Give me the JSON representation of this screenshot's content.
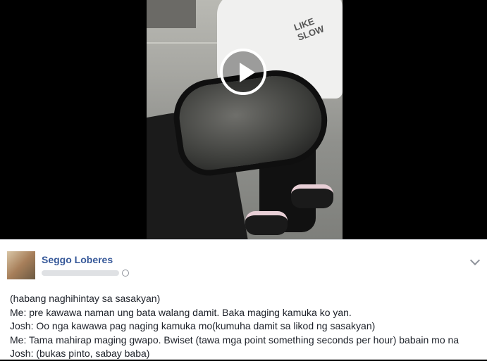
{
  "video": {
    "shirt_text": "LIKE SLOW",
    "play_icon": "play-circle-icon"
  },
  "post": {
    "author": "Seggo Loberes",
    "privacy_icon": "globe-icon",
    "menu_icon": "chevron-down-icon",
    "lines": [
      "(habang naghihintay sa sasakyan)",
      "Me: pre kawawa naman ung bata walang damit. Baka maging kamuka ko yan.",
      "Josh: Oo nga kawawa pag naging kamuka mo(kumuha damit sa likod ng sasakyan)",
      "Me: Tama mahirap maging gwapo. Bwiset (tawa mga point something seconds per hour) babain mo na",
      "Josh: (bukas pinto, sabay baba)"
    ]
  },
  "colors": {
    "author": "#365899",
    "text": "#1d2129",
    "meta": "#90949c",
    "background": "#000000",
    "card": "#ffffff"
  }
}
